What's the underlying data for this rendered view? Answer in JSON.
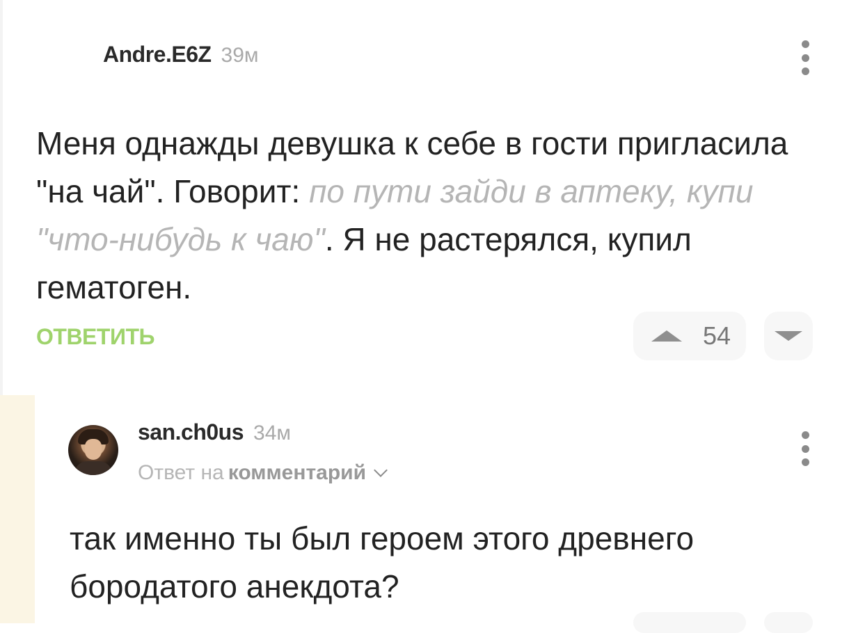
{
  "comment1": {
    "author": "Andre.E6Z",
    "time": "39м",
    "text_part1": "Меня однажды девушка к себе в гости пригласила \"на чай\". Говорит: ",
    "text_quote": "по пути зайди в аптеку, купи \"что-нибудь к чаю\"",
    "text_part2": ". Я не растерялся, купил гематоген.",
    "reply_label": "ОТВЕТИТЬ",
    "rating": "54"
  },
  "comment2": {
    "author": "san.ch0us",
    "time": "34м",
    "reply_prefix": "Ответ на",
    "reply_target": "комментарий",
    "text": "так именно ты был героем этого древнего бородатого анекдота?"
  },
  "icons": {
    "more": "more-vertical-icon",
    "upvote": "triangle-up-icon",
    "downvote": "triangle-down-icon",
    "expand": "chevron-down-icon"
  },
  "colors": {
    "reply_link": "#9fd36c",
    "quote": "#b5b5b5",
    "thread_gutter": "#fbf5e4"
  }
}
